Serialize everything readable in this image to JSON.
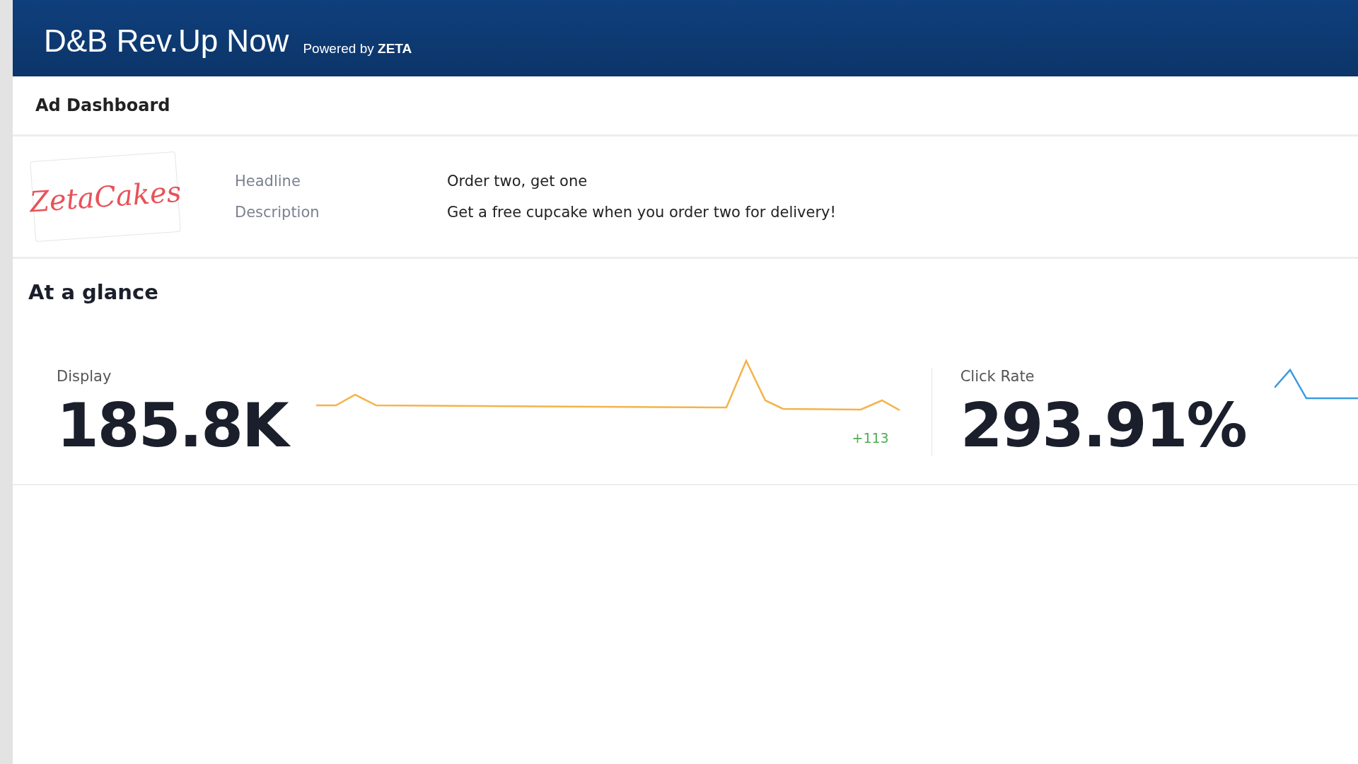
{
  "header": {
    "brand": "D&B Rev.Up Now",
    "powered_by": "Powered by ",
    "powered_brand": "ZETA"
  },
  "page_title": "Ad Dashboard",
  "ad": {
    "logo_text": "ZetaCakes",
    "fields": [
      {
        "label": "Headline",
        "value": "Order two, get one"
      },
      {
        "label": "Description",
        "value": "Get a free cupcake when you order two for delivery!"
      }
    ]
  },
  "glance": {
    "title": "At a glance",
    "metrics": [
      {
        "label": "Display",
        "value": "185.8K",
        "delta": "+113",
        "color": "#f5b34a"
      },
      {
        "label": "Click Rate",
        "value": "293.91%",
        "color": "#3b9be0"
      }
    ]
  }
}
